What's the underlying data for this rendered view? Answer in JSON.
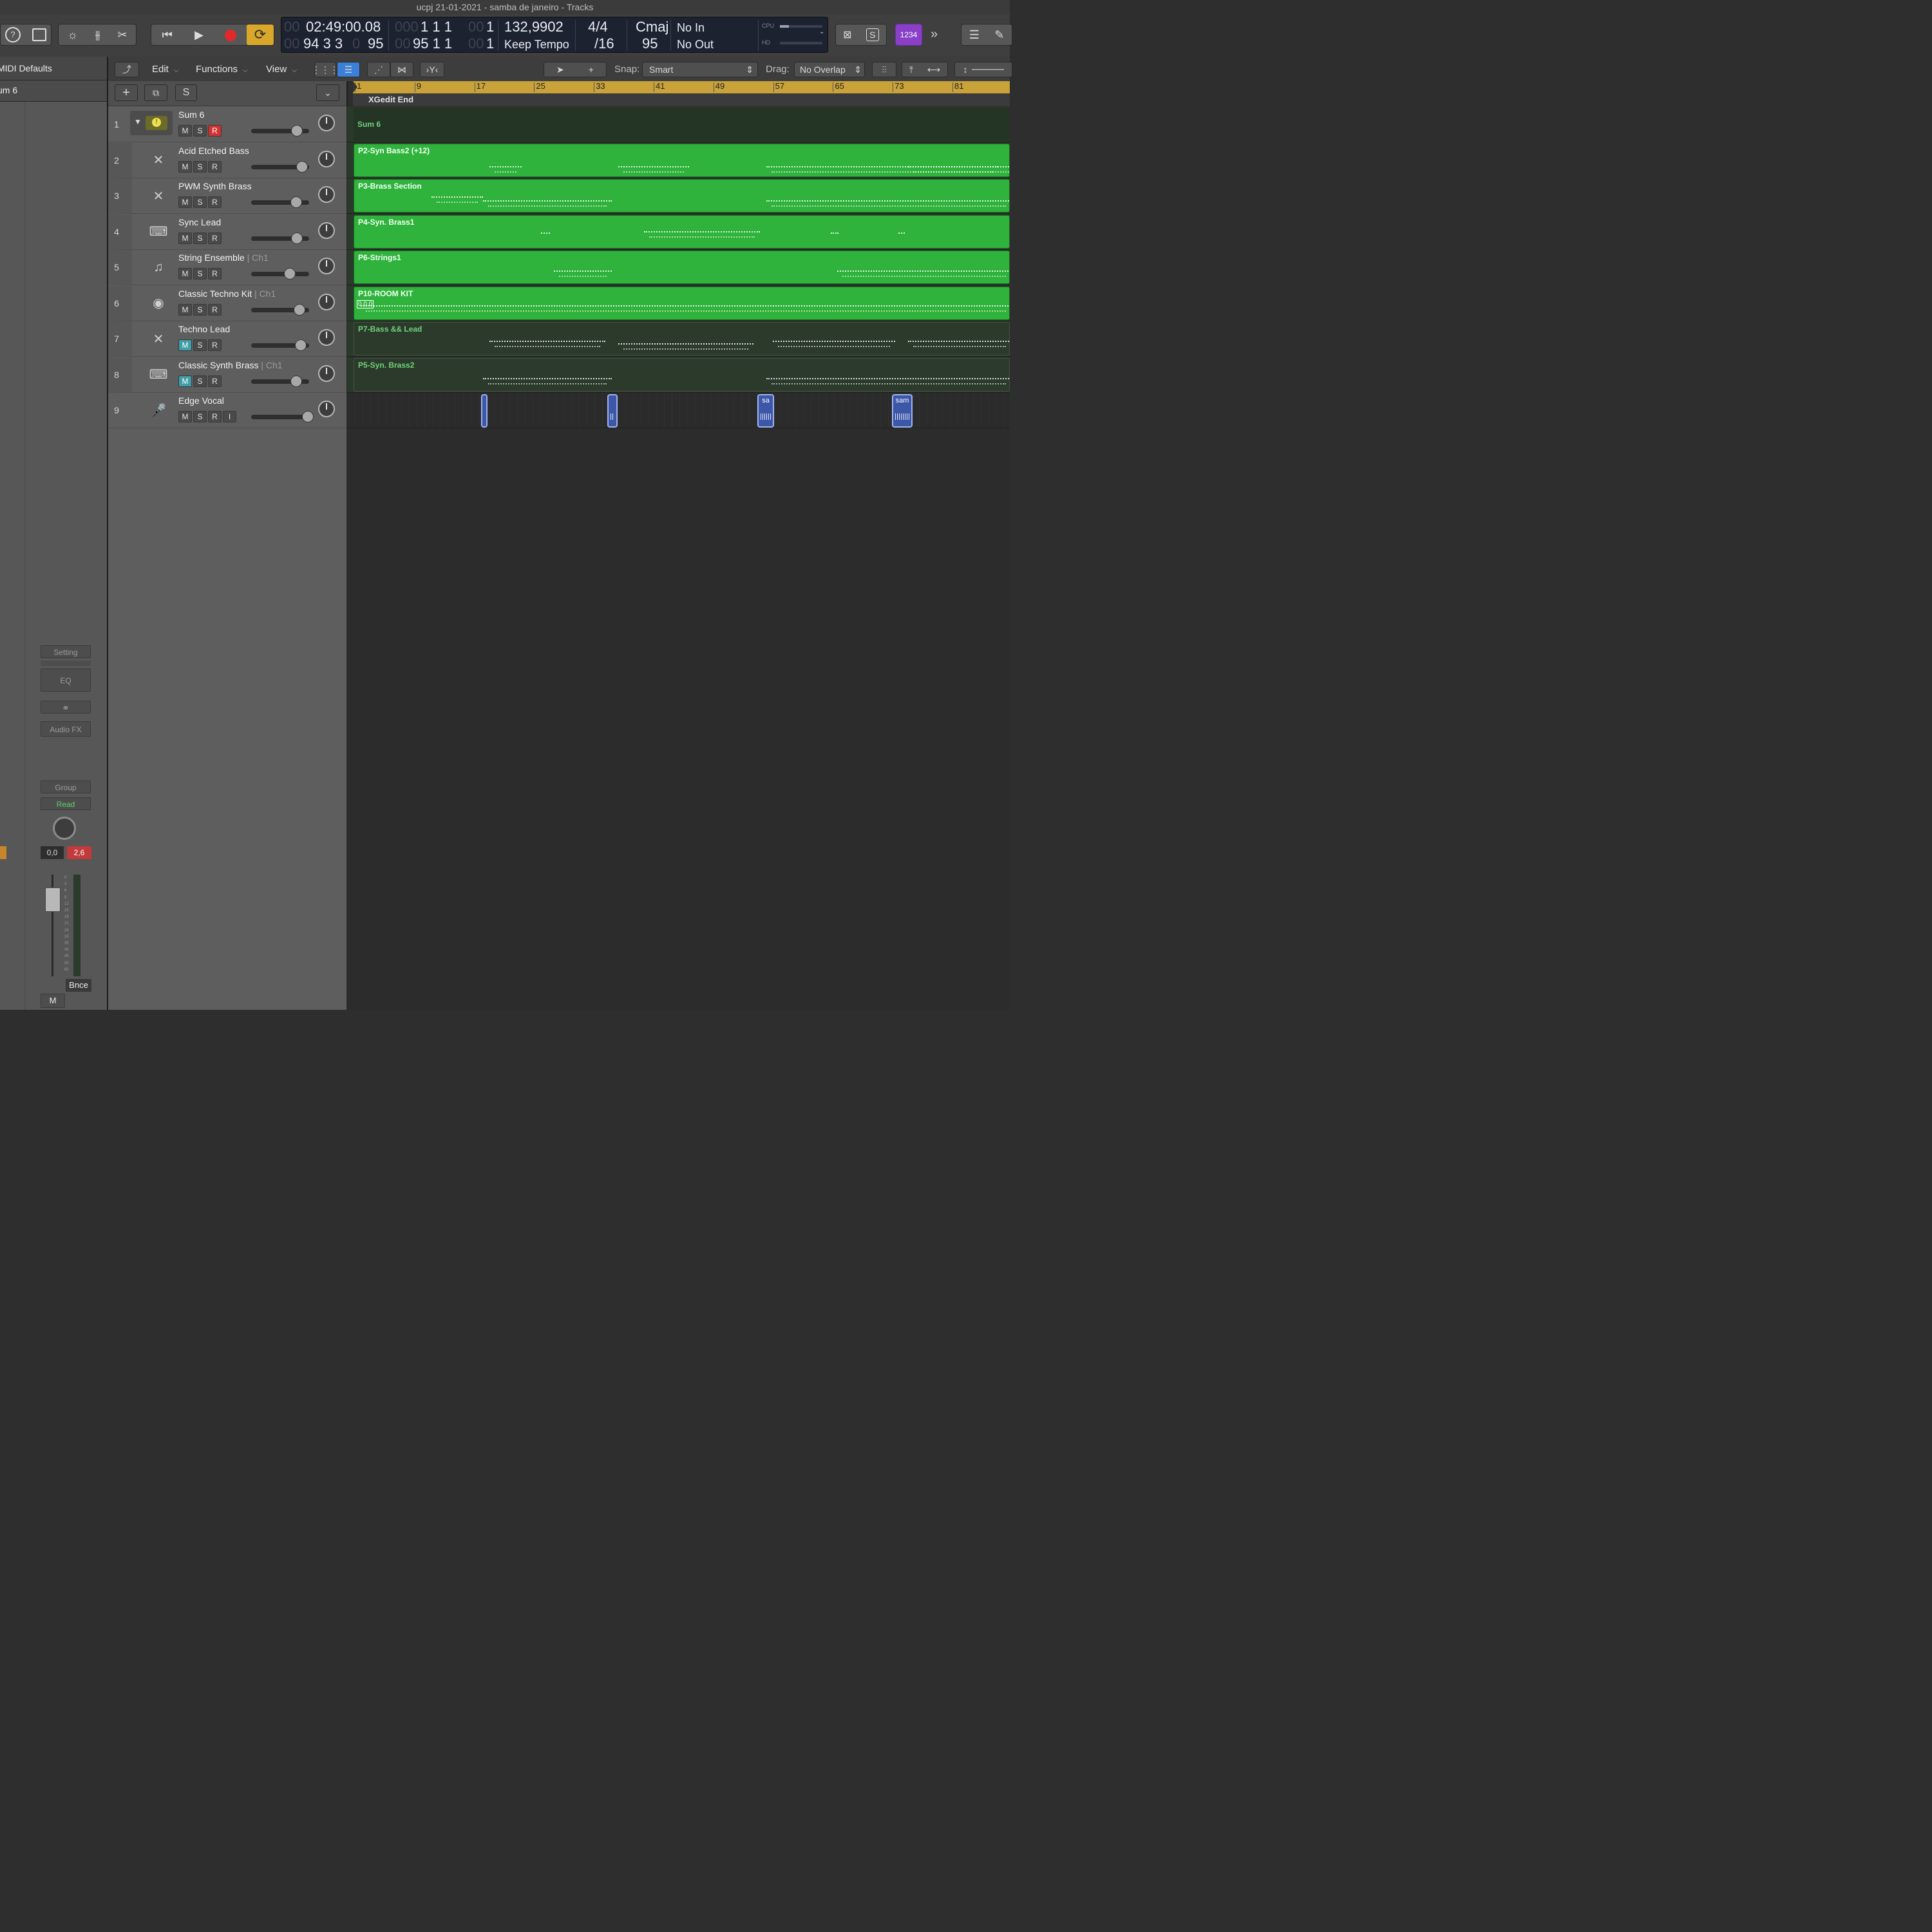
{
  "window": {
    "title": "ucpj 21-01-2021 - samba de janeiro - Tracks"
  },
  "lcd": {
    "time": "02:49:00.08",
    "time_prefix": "00",
    "bars": "94 3 3",
    "bars_prefix": "00",
    "bars_tick": "95",
    "bars_tick_prefix": "0",
    "left_locator": "1  1  1",
    "left_locator_prefix": "000",
    "left_locator_sub": "1",
    "left_locator_sub_prefix": "00",
    "right_locator": "95  1  1",
    "right_locator_prefix": "00",
    "right_locator_sub": "1",
    "right_locator_sub_prefix": "00",
    "tempo": "132,9902",
    "tempo_mode": "Keep Tempo",
    "signature": "4/4",
    "division": "/16",
    "key": "Cmaj",
    "key_value": "95",
    "midi_in": "No In",
    "midi_out": "No Out",
    "cpu_label": "CPU",
    "hd_label": "HD"
  },
  "toolbar": {
    "count_in": "1234"
  },
  "inspector": {
    "header": "MIDI Defaults",
    "region": "um 6",
    "setting": "Setting",
    "eq": "EQ",
    "audio_fx": "Audio FX",
    "group": "Group",
    "automation": "Read",
    "vol": "0,0",
    "peak": "2,6",
    "bounce": "Bnce",
    "mute": "M",
    "scale": [
      "0",
      "3",
      "6",
      "9",
      "12",
      "15",
      "18",
      "21",
      "24",
      "30",
      "35",
      "40",
      "45",
      "50",
      "60"
    ]
  },
  "menu": {
    "edit": "Edit",
    "functions": "Functions",
    "view": "View",
    "snap_label": "Snap:",
    "snap_value": "Smart",
    "drag_label": "Drag:",
    "drag_value": "No Overlap"
  },
  "tracklist_header": {
    "add": "+",
    "solo": "S"
  },
  "ruler": {
    "bars": [
      "1",
      "9",
      "17",
      "25",
      "33",
      "41",
      "49",
      "57",
      "65",
      "73",
      "81"
    ],
    "marker": "XGedit End"
  },
  "tracks": [
    {
      "num": "1",
      "name": "Sum 6",
      "ch": "",
      "mute": "M",
      "solo": "S",
      "rec": "R",
      "rec_on": true,
      "muted": false,
      "volume": 0.75
    },
    {
      "num": "2",
      "name": "Acid Etched Bass",
      "ch": "",
      "mute": "M",
      "solo": "S",
      "rec": "R",
      "rec_on": false,
      "muted": false,
      "volume": 0.85
    },
    {
      "num": "3",
      "name": "PWM Synth Brass",
      "ch": "",
      "mute": "M",
      "solo": "S",
      "rec": "R",
      "rec_on": false,
      "muted": false,
      "volume": 0.74
    },
    {
      "num": "4",
      "name": "Sync Lead",
      "ch": "",
      "mute": "M",
      "solo": "S",
      "rec": "R",
      "rec_on": false,
      "muted": false,
      "volume": 0.75
    },
    {
      "num": "5",
      "name": "String Ensemble",
      "ch": "| Ch1",
      "mute": "M",
      "solo": "S",
      "rec": "R",
      "rec_on": false,
      "muted": false,
      "volume": 0.62
    },
    {
      "num": "6",
      "name": "Classic Techno Kit",
      "ch": "| Ch1",
      "mute": "M",
      "solo": "S",
      "rec": "R",
      "rec_on": false,
      "muted": false,
      "volume": 0.8
    },
    {
      "num": "7",
      "name": "Techno Lead",
      "ch": "",
      "mute": "M",
      "solo": "S",
      "rec": "R",
      "rec_on": false,
      "muted": true,
      "volume": 0.83
    },
    {
      "num": "8",
      "name": "Classic Synth Brass",
      "ch": "| Ch1",
      "mute": "M",
      "solo": "S",
      "rec": "R",
      "rec_on": false,
      "muted": true,
      "volume": 0.74
    },
    {
      "num": "9",
      "name": "Edge Vocal",
      "ch": "",
      "mute": "M",
      "solo": "S",
      "rec": "R",
      "input": "I",
      "rec_on": false,
      "muted": false,
      "volume": 0.96
    }
  ],
  "regions": [
    {
      "label": "Sum 6",
      "style": "folder"
    },
    {
      "label": "P2-Syn Bass2 (+12)",
      "style": "green"
    },
    {
      "label": "P3-Brass Section",
      "style": "green"
    },
    {
      "label": "P4-Syn. Brass1",
      "style": "green"
    },
    {
      "label": "P6-Strings1",
      "style": "green"
    },
    {
      "label": "P10-ROOM KIT",
      "style": "green",
      "sub": "0.0.0"
    },
    {
      "label": "P7-Bass && Lead",
      "style": "dark"
    },
    {
      "label": "P5-Syn. Brass2",
      "style": "dark"
    }
  ],
  "audio_regions": [
    {
      "label": ""
    },
    {
      "label": ""
    },
    {
      "label": "sa"
    },
    {
      "label": "sam"
    }
  ]
}
